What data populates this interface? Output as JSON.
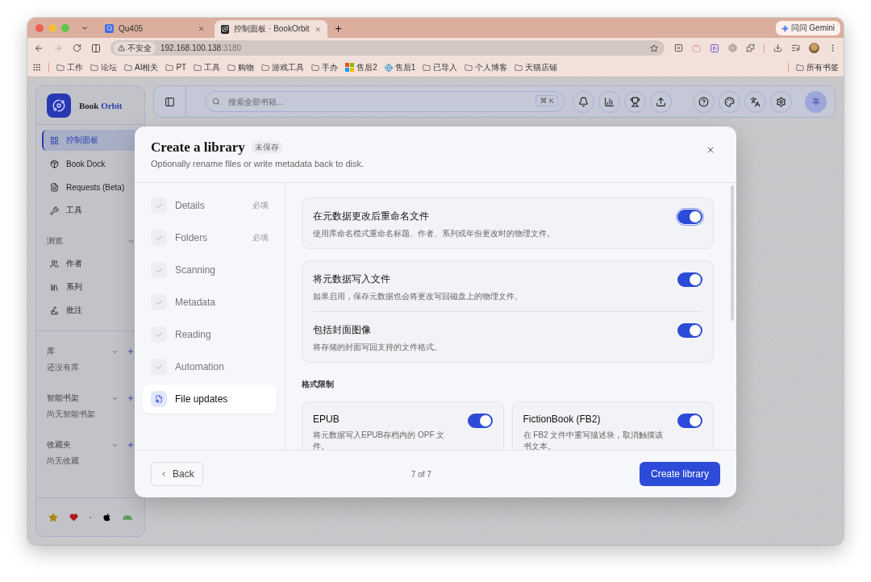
{
  "browser": {
    "tabs": [
      {
        "title": "Qu405",
        "selected": false
      },
      {
        "title": "控制面板 · BookOrbit",
        "selected": true
      }
    ],
    "gemini_button": "问问 Gemini",
    "address": {
      "security": "不安全",
      "host": "192.168.100.138",
      "port": ":3180"
    },
    "bookmarks": [
      {
        "label": "工作",
        "kind": "folder"
      },
      {
        "label": "论坛",
        "kind": "folder"
      },
      {
        "label": "AI相关",
        "kind": "folder"
      },
      {
        "label": "PT",
        "kind": "folder"
      },
      {
        "label": "工具",
        "kind": "folder"
      },
      {
        "label": "购物",
        "kind": "folder"
      },
      {
        "label": "游戏工具",
        "kind": "folder"
      },
      {
        "label": "手办",
        "kind": "folder"
      },
      {
        "label": "售后2",
        "kind": "tiles"
      },
      {
        "label": "售后1",
        "kind": "site"
      },
      {
        "label": "已导入",
        "kind": "folder"
      },
      {
        "label": "个人博客",
        "kind": "folder"
      },
      {
        "label": "天猫店铺",
        "kind": "folder"
      }
    ],
    "all_bookmarks": "所有书签"
  },
  "app": {
    "brand": {
      "first": "Book",
      "second": "Orbit"
    },
    "nav": [
      {
        "label": "控制面板",
        "selected": true
      },
      {
        "label": "Book Dock",
        "selected": false
      },
      {
        "label": "Requests (Beta)",
        "selected": false
      },
      {
        "label": "工具",
        "selected": false
      }
    ],
    "browse": {
      "title": "浏览",
      "items": [
        {
          "label": "作者"
        },
        {
          "label": "系列"
        },
        {
          "label": "批注"
        }
      ]
    },
    "groups": [
      {
        "title": "库",
        "empty": "还没有库"
      },
      {
        "title": "智能书架",
        "empty": "尚无智能书架"
      },
      {
        "title": "收藏夹",
        "empty": "尚无收藏"
      }
    ],
    "search": {
      "placeholder": "搜索全部书籍...",
      "shortcut": "⌘ K"
    },
    "avatar": "羊"
  },
  "modal": {
    "title": "Create a library",
    "badge": "未保存",
    "subtitle": "Optionally rename files or write metadata back to disk.",
    "steps": [
      {
        "label": "Details",
        "tag": "必填",
        "selected": false
      },
      {
        "label": "Folders",
        "tag": "必填",
        "selected": false
      },
      {
        "label": "Scanning",
        "selected": false
      },
      {
        "label": "Metadata",
        "selected": false
      },
      {
        "label": "Reading",
        "selected": false
      },
      {
        "label": "Automation",
        "selected": false
      },
      {
        "label": "File updates",
        "selected": true
      }
    ],
    "cards": [
      [
        {
          "title": "在元数据更改后重命名文件",
          "description": "使用库命名模式重命名标题、作者、系列或年份更改时的物理文件。",
          "on": true,
          "focused": true
        }
      ],
      [
        {
          "title": "将元数据写入文件",
          "description": "如果启用，保存元数据也会将更改写回磁盘上的物理文件。",
          "on": true,
          "focused": false
        },
        {
          "title": "包括封面图像",
          "description": "将存储的封面写回支持的文件格式。",
          "on": true,
          "focused": false
        }
      ]
    ],
    "formats_title": "格式限制",
    "formats": [
      {
        "title": "EPUB",
        "description": "将元数据写入EPUB存档内的 OPF 文件。",
        "on": true
      },
      {
        "title": "FictionBook (FB2)",
        "description": "在 FB2 文件中重写描述块，取消触摸该书文本。",
        "on": true
      }
    ],
    "back": "Back",
    "progress": "7 of 7",
    "submit": "Create library"
  }
}
